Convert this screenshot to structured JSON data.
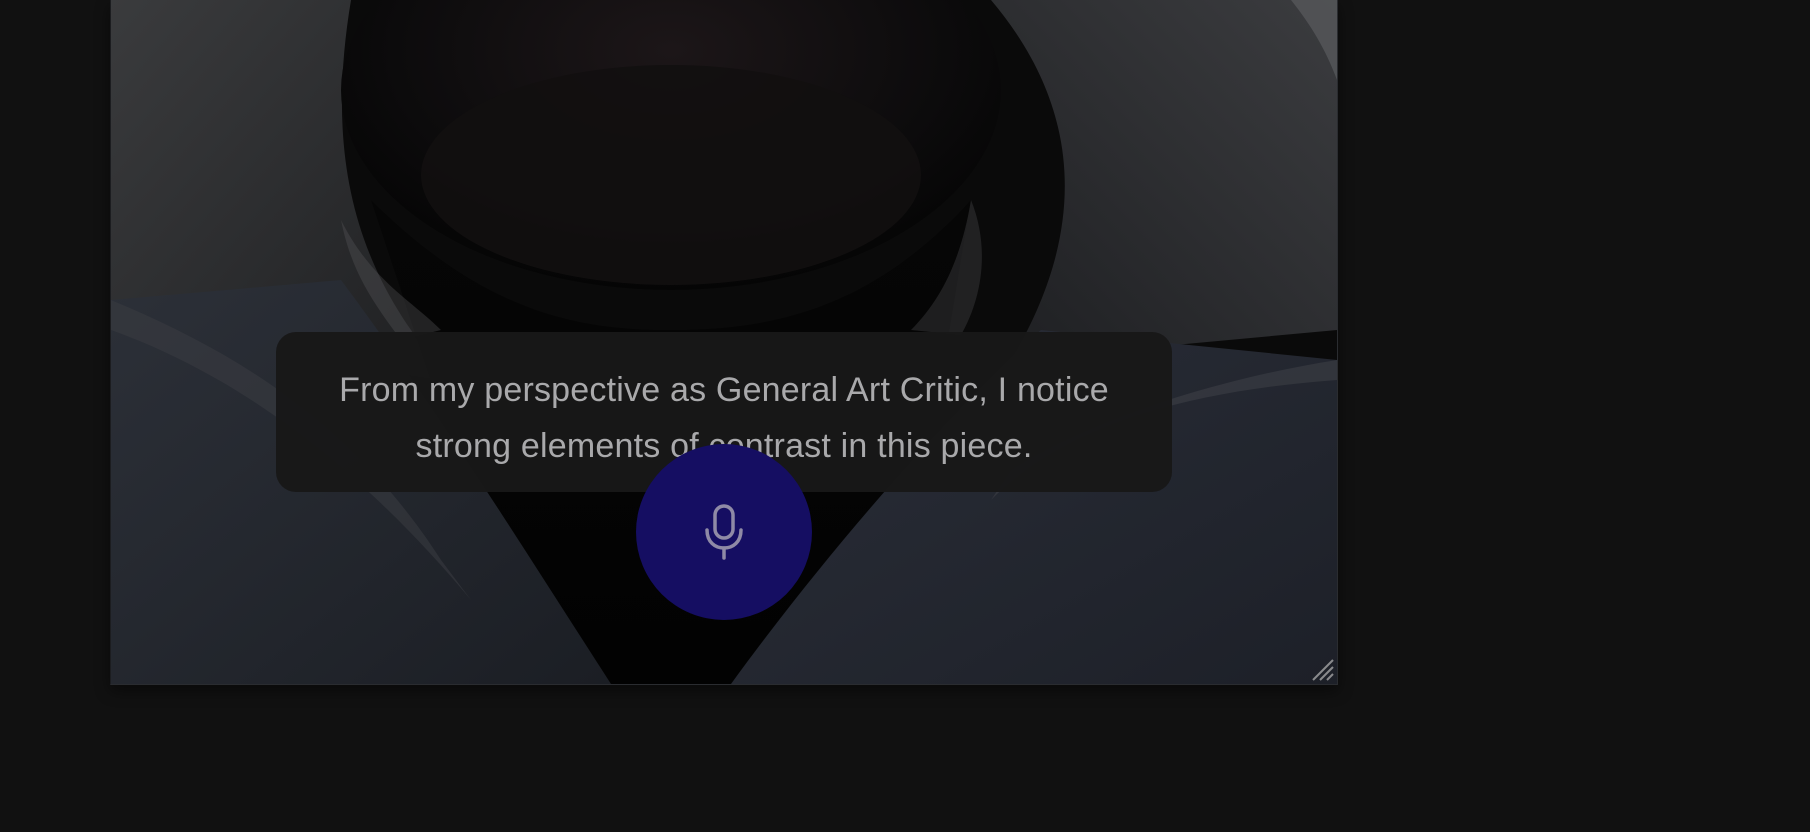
{
  "caption": {
    "text": "From my perspective as General Art Critic, I notice strong elements of contrast in this piece."
  },
  "mic_button": {
    "icon": "microphone-icon",
    "color": "#150e62"
  },
  "video": {
    "icon_resize": "resize-handle-icon"
  },
  "colors": {
    "page_background": "#111111",
    "caption_background": "#181818",
    "caption_text": "#a9a9ab"
  }
}
